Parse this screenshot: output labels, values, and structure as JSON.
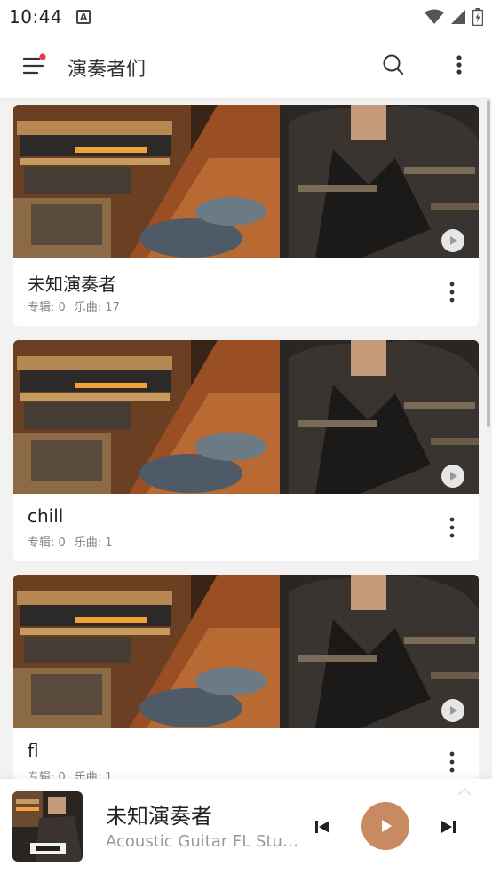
{
  "status_bar": {
    "time": "10:44",
    "notification_glyph": "A"
  },
  "app_bar": {
    "title": "演奏者们"
  },
  "artists": [
    {
      "name": "未知演奏者",
      "albums_label": "专辑: 0",
      "songs_label": "乐曲: 17"
    },
    {
      "name": "chill",
      "albums_label": "专辑: 0",
      "songs_label": "乐曲: 1"
    },
    {
      "name": "fl",
      "albums_label": "专辑: 0",
      "songs_label": "乐曲: 1"
    }
  ],
  "player": {
    "title": "未知演奏者",
    "subtitle": "Acoustic Guitar FL Stud.."
  },
  "colors": {
    "accent": "#c98a62",
    "menu_badge": "#e53950"
  }
}
